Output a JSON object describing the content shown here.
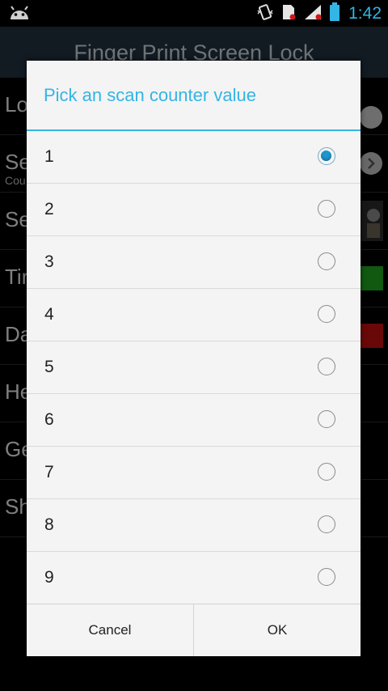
{
  "status_bar": {
    "time": "1:42",
    "left_icon": "android-debug-icon",
    "right_icons": [
      "vibrate-icon",
      "sd-card-icon",
      "signal-icon",
      "battery-icon"
    ]
  },
  "app": {
    "title": "Finger Print Screen Lock",
    "rows": [
      {
        "label": "Lo"
      },
      {
        "label": "Se",
        "sub": "Cou"
      },
      {
        "label": "Se"
      },
      {
        "label": "Tir"
      },
      {
        "label": "Da"
      },
      {
        "label": "He"
      },
      {
        "label": "Ge"
      },
      {
        "label": "Sh"
      }
    ]
  },
  "dialog": {
    "title": "Pick an scan counter value",
    "selected": "1",
    "options": [
      {
        "label": "1",
        "checked": true
      },
      {
        "label": "2",
        "checked": false
      },
      {
        "label": "3",
        "checked": false
      },
      {
        "label": "4",
        "checked": false
      },
      {
        "label": "5",
        "checked": false
      },
      {
        "label": "6",
        "checked": false
      },
      {
        "label": "7",
        "checked": false
      },
      {
        "label": "8",
        "checked": false
      },
      {
        "label": "9",
        "checked": false
      }
    ],
    "cancel_label": "Cancel",
    "ok_label": "OK"
  },
  "colors": {
    "accent": "#33b5e5",
    "radio_selected": "#1e96cf",
    "actionbar": "#21313f",
    "green_swatch": "#1fa01f",
    "red_swatch": "#c01010"
  }
}
